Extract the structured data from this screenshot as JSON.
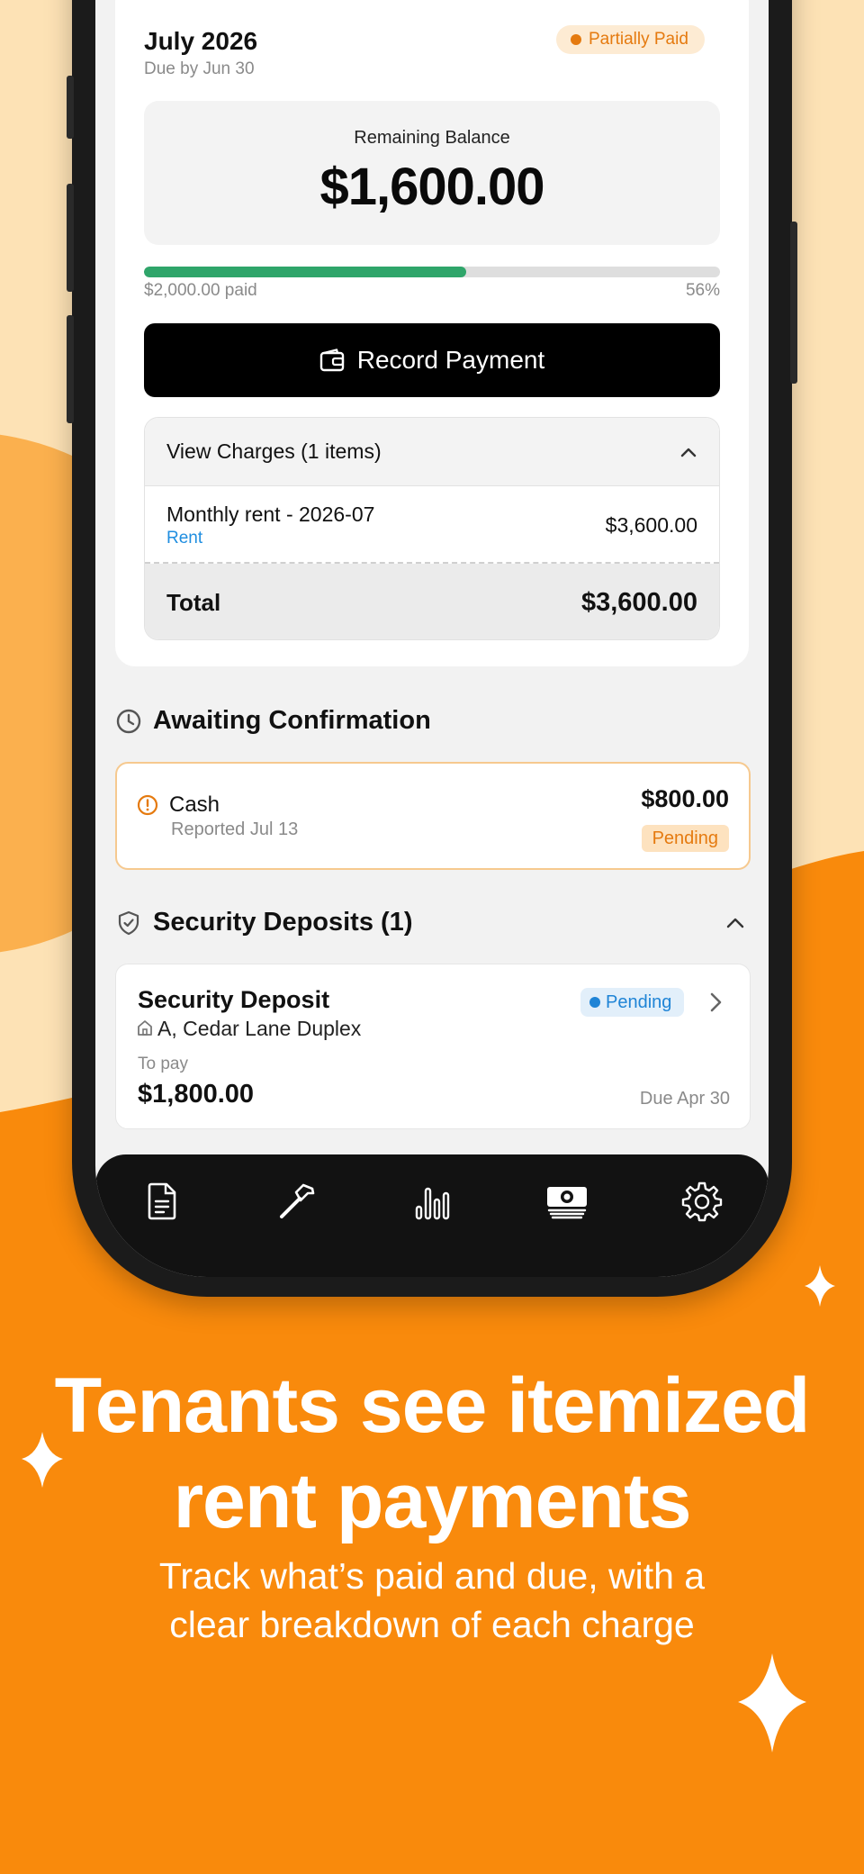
{
  "bill": {
    "month": "July 2026",
    "due": "Due by Jun 30",
    "status": "Partially Paid",
    "balance_label": "Remaining Balance",
    "balance": "$1,600.00",
    "paid_text": "$2,000.00 paid",
    "percent_text": "56%",
    "progress_fraction": 0.56,
    "record_label": "Record Payment"
  },
  "charges": {
    "header": "View Charges (1 items)",
    "items": [
      {
        "name": "Monthly rent - 2026-07",
        "category": "Rent",
        "amount": "$3,600.00"
      }
    ],
    "total_label": "Total",
    "total_amount": "$3,600.00"
  },
  "awaiting": {
    "title": "Awaiting Confirmation",
    "method": "Cash",
    "reported": "Reported Jul 13",
    "amount": "$800.00",
    "status": "Pending"
  },
  "deposits": {
    "title": "Security Deposits (1)",
    "item": {
      "title": "Security Deposit",
      "property": "A, Cedar Lane Duplex",
      "status": "Pending",
      "to_pay_label": "To pay",
      "amount": "$1,800.00",
      "due": "Due Apr 30"
    }
  },
  "tabbar": {
    "icons": [
      "document-icon",
      "hammer-icon",
      "bar-chart-icon",
      "cash-icon",
      "gear-icon"
    ]
  },
  "marketing": {
    "headline_line1": "Tenants see itemized",
    "headline_line2": "rent payments",
    "subline_line1": "Track what’s paid and due, with a",
    "subline_line2": "clear breakdown of each charge"
  },
  "colors": {
    "brand_orange": "#f98a0c",
    "light_peach": "#fde2b5",
    "partial_paid": "#e57a0f",
    "progress_green": "#2fa56a",
    "link_blue": "#1f8ee0"
  }
}
